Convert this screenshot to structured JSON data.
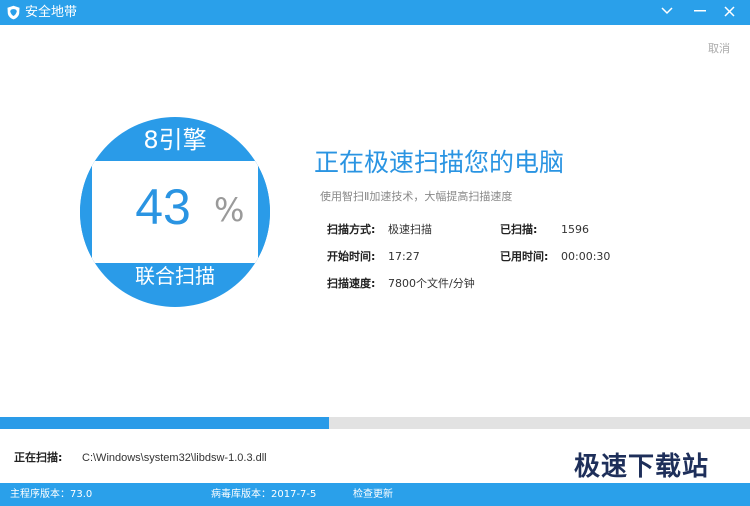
{
  "window": {
    "title": "安全地带",
    "dropdown_icon": "chevron-down-icon",
    "minimize_icon": "minimize-icon",
    "close_icon": "close-icon"
  },
  "cancel_label": "取消",
  "gauge": {
    "engine_label": "8引擎",
    "percent": "43",
    "percent_sign": "%",
    "scan_mode_label": "联合扫描",
    "ring_color": "#2a9be8"
  },
  "main": {
    "heading": "正在极速扫描您的电脑",
    "subtitle": "使用智扫Ⅱ加速技术，大幅提高扫描速度"
  },
  "info": {
    "scan_mode_label": "扫描方式:",
    "scan_mode_value": "极速扫描",
    "scanned_label": "已扫描:",
    "scanned_value": "1596",
    "start_time_label": "开始时间:",
    "start_time_value": "17:27",
    "elapsed_label": "已用时间:",
    "elapsed_value": "00:00:30",
    "speed_label": "扫描速度:",
    "speed_value": "7800个文件/分钟"
  },
  "progress": {
    "value": 0.438,
    "fill_color": "#2a9be8",
    "track_color": "#e2e2e2"
  },
  "current": {
    "label": "正在扫描:",
    "path": "C:\\Windows\\system32\\libdsw-1.0.3.dll"
  },
  "watermark": "极速下载站",
  "statusbar": {
    "program_version": "主程序版本：73.0",
    "virus_db_version": "病毒库版本：2017-7-5",
    "check_update": "检查更新"
  },
  "colors": {
    "accent": "#2aa0ea",
    "heading": "#2a94e2"
  }
}
